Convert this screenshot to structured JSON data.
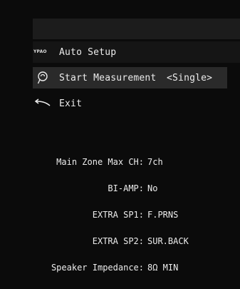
{
  "menu": {
    "title": {
      "icon": "brand-logo-icon",
      "icon_text": "YPAO",
      "label": "Auto Setup"
    },
    "start_measurement": {
      "icon": "microphone-icon",
      "label": "Start Measurement",
      "value": "<Single>"
    },
    "exit": {
      "icon": "return-arrow-icon",
      "label": "Exit"
    }
  },
  "info": [
    {
      "label": "Main Zone Max CH:",
      "value": "7ch"
    },
    {
      "label": "BI-AMP:",
      "value": "No"
    },
    {
      "label": "EXTRA SP1:",
      "value": "F.PRNS"
    },
    {
      "label": "EXTRA SP2:",
      "value": "SUR.BACK"
    },
    {
      "label": "Speaker Impedance:",
      "value": "8Ω MIN"
    }
  ],
  "colors": {
    "background": "#0b0b0b",
    "highlight": "#2a2a2a",
    "text": "#ececec"
  }
}
